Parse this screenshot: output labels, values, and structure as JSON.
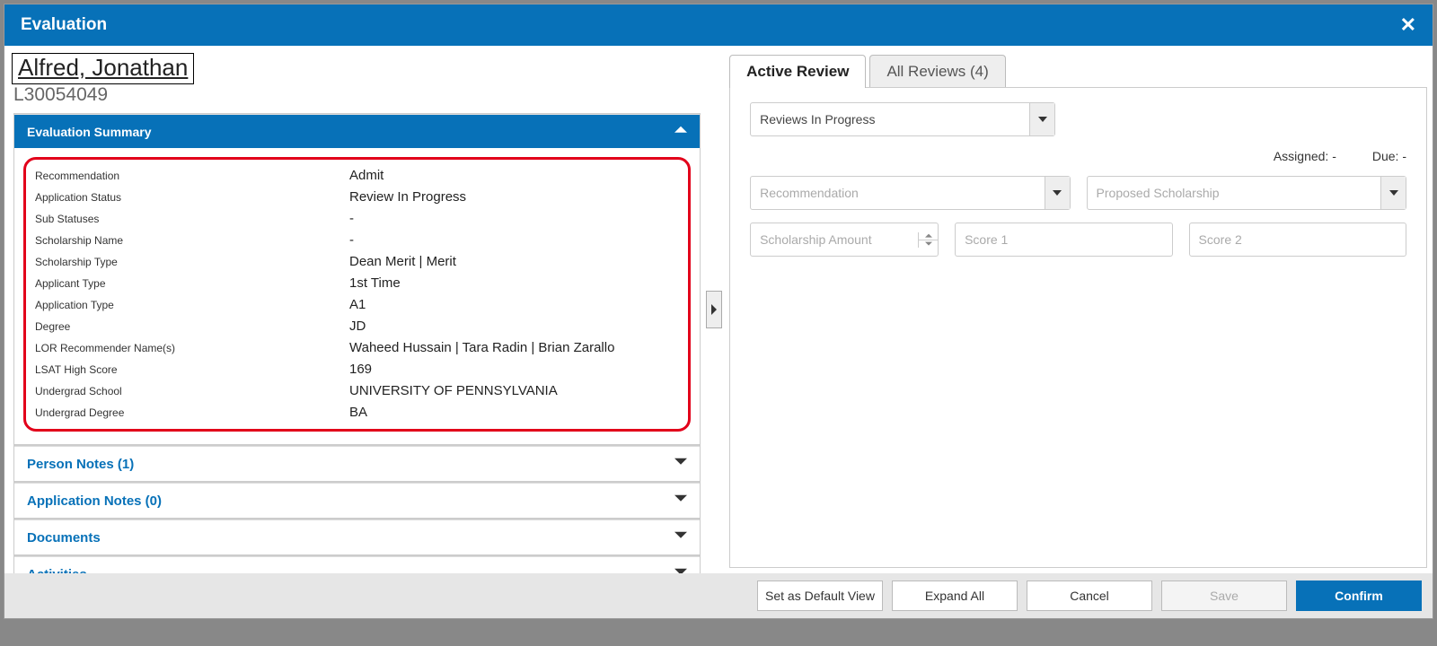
{
  "title_bar": {
    "title": "Evaluation"
  },
  "applicant": {
    "name": "Alfred, Jonathan",
    "id": "L30054049"
  },
  "panels": {
    "evaluation_summary": {
      "title": "Evaluation Summary"
    },
    "person_notes": {
      "title": "Person Notes (1)"
    },
    "application_notes": {
      "title": "Application Notes (0)"
    },
    "documents": {
      "title": "Documents"
    },
    "activities": {
      "title": "Activities"
    }
  },
  "summary_rows": [
    {
      "label": "Recommendation",
      "value": "Admit"
    },
    {
      "label": "Application Status",
      "value": "Review In Progress"
    },
    {
      "label": "Sub Statuses",
      "value": "-"
    },
    {
      "label": "Scholarship Name",
      "value": "-"
    },
    {
      "label": "Scholarship Type",
      "value": "Dean Merit | Merit"
    },
    {
      "label": "Applicant Type",
      "value": "1st Time"
    },
    {
      "label": "Application Type",
      "value": "A1"
    },
    {
      "label": "Degree",
      "value": "JD"
    },
    {
      "label": "LOR Recommender Name(s)",
      "value": "Waheed Hussain | Tara Radin | Brian Zarallo"
    },
    {
      "label": "LSAT High Score",
      "value": "169"
    },
    {
      "label": "Undergrad School",
      "value": "UNIVERSITY OF PENNSYLVANIA"
    },
    {
      "label": "Undergrad Degree",
      "value": "BA"
    }
  ],
  "tabs": {
    "active": "Active Review",
    "all": "All Reviews (4)"
  },
  "review_form": {
    "status_select": "Reviews In Progress",
    "assigned_label": "Assigned: -",
    "due_label": "Due: -",
    "recommendation_placeholder": "Recommendation",
    "proposed_scholarship_placeholder": "Proposed Scholarship",
    "scholarship_amount_placeholder": "Scholarship Amount",
    "score1_placeholder": "Score 1",
    "score2_placeholder": "Score 2"
  },
  "footer": {
    "default_view": "Set as Default View",
    "expand_all": "Expand All",
    "cancel": "Cancel",
    "save": "Save",
    "confirm": "Confirm"
  }
}
